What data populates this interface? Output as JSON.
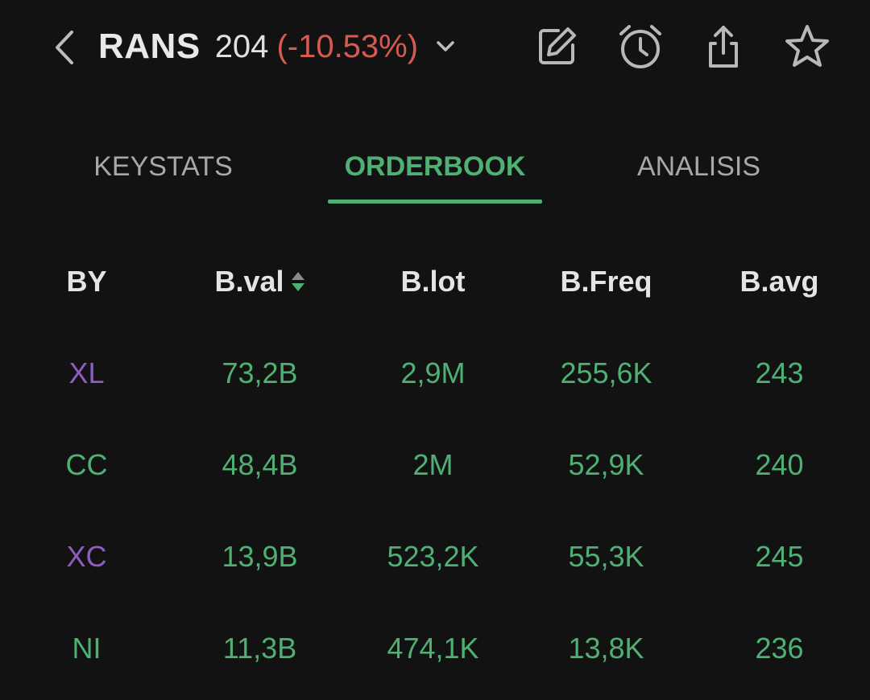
{
  "header": {
    "ticker": "RANS",
    "price": "204",
    "change": "(-10.53%)",
    "icons": [
      "back-chevron-icon",
      "chevron-down-icon",
      "edit-icon",
      "alarm-icon",
      "share-icon",
      "star-icon"
    ]
  },
  "tabs": [
    {
      "label": "KEYSTATS",
      "active": false
    },
    {
      "label": "ORDERBOOK",
      "active": true
    },
    {
      "label": "ANALISIS",
      "active": false
    }
  ],
  "table": {
    "columns": [
      "BY",
      "B.val",
      "B.lot",
      "B.Freq",
      "B.avg"
    ],
    "rows": [
      {
        "by": "XL",
        "bval": "73,2B",
        "blot": "2,9M",
        "bfreq": "255,6K",
        "bavg": "243",
        "by_color": "#8e5cc2"
      },
      {
        "by": "CC",
        "bval": "48,4B",
        "blot": "2M",
        "bfreq": "52,9K",
        "bavg": "240",
        "by_color": "#4fb074"
      },
      {
        "by": "XC",
        "bval": "13,9B",
        "blot": "523,2K",
        "bfreq": "55,3K",
        "bavg": "245",
        "by_color": "#8e5cc2"
      },
      {
        "by": "NI",
        "bval": "11,3B",
        "blot": "474,1K",
        "bfreq": "13,8K",
        "bavg": "236",
        "by_color": "#4fb074"
      }
    ]
  },
  "colors": {
    "background": "#121212",
    "accent_green": "#4fb074",
    "negative_red": "#d65a52",
    "broker_purple": "#8e5cc2"
  }
}
